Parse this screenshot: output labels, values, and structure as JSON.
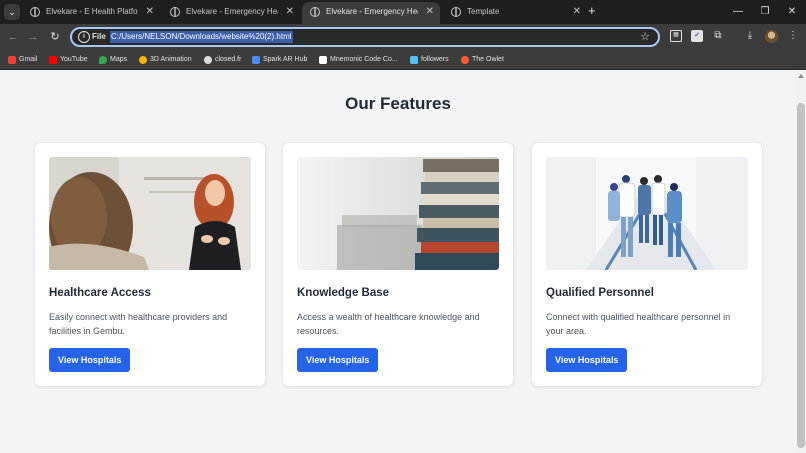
{
  "browser": {
    "tabs": [
      {
        "title": "Elvekare - E Health Platform for",
        "active": false
      },
      {
        "title": "Elvekare - Emergency Healthcare",
        "active": false
      },
      {
        "title": "Elvekare - Emergency Healthcare",
        "active": true
      },
      {
        "title": "Template",
        "active": false
      }
    ],
    "address": {
      "scheme_label": "File",
      "url": "C:/Users/NELSON/Downloads/website%20(2).html"
    },
    "bookmarks": [
      {
        "label": "Gmail",
        "icon_color": "#ea4335"
      },
      {
        "label": "YouTube",
        "icon_color": "#ff0000"
      },
      {
        "label": "Maps",
        "icon_color": "#34a853"
      },
      {
        "label": "3D Animation",
        "icon_color": "#f4b400"
      },
      {
        "label": "closed.fr",
        "icon_color": "#dddddd"
      },
      {
        "label": "Spark AR Hub",
        "icon_color": "#4c8bf5"
      },
      {
        "label": "Mnemonic Code Co...",
        "icon_color": "#ffffff"
      },
      {
        "label": "followers",
        "icon_color": "#4fc3f7"
      },
      {
        "label": "The Owlet",
        "icon_color": "#ff5a36"
      }
    ]
  },
  "page": {
    "section_title": "Our Features",
    "features": [
      {
        "title": "Healthcare Access",
        "description": "Easily connect with healthcare providers and facilities in Gembu.",
        "button_label": "View Hospitals",
        "image": "two-women-talking-photo"
      },
      {
        "title": "Knowledge Base",
        "description": "Access a wealth of healthcare knowledge and resources.",
        "button_label": "View Hospitals",
        "image": "stack-of-books-photo"
      },
      {
        "title": "Qualified Personnel",
        "description": "Connect with qualified healthcare personnel in your area.",
        "button_label": "View Hospitals",
        "image": "medical-staff-hallway-photo"
      }
    ]
  },
  "colors": {
    "accent": "#2563eb",
    "page_background": "#f3f4f6",
    "heading": "#1f2937"
  }
}
